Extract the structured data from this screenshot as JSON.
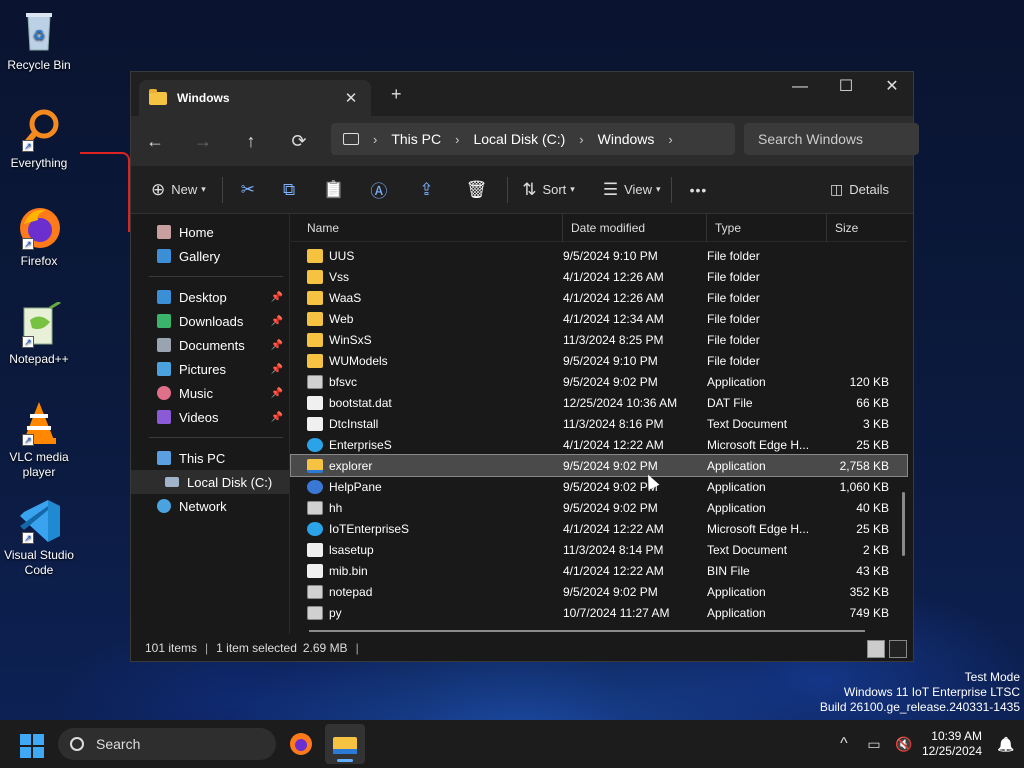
{
  "desktop": {
    "icons": [
      {
        "label": "Recycle Bin",
        "icon": "recycle-bin-icon"
      },
      {
        "label": "Everything",
        "icon": "everything-search-icon"
      },
      {
        "label": "Firefox",
        "icon": "firefox-icon"
      },
      {
        "label": "Notepad++",
        "icon": "notepad-plus-plus-icon"
      },
      {
        "label": "VLC media player",
        "icon": "vlc-icon"
      },
      {
        "label": "Visual Studio Code",
        "icon": "vscode-icon"
      }
    ]
  },
  "window": {
    "tab_title": "Windows",
    "tab_close": "✕",
    "new_tab": "+",
    "minimize": "—",
    "maximize": "☐",
    "close": "✕",
    "nav": {
      "back": "←",
      "forward": "→",
      "up": "↑",
      "refresh": "⟳"
    },
    "breadcrumb": [
      "This PC",
      "Local Disk (C:)",
      "Windows"
    ],
    "breadcrumb_sep": "›",
    "search_placeholder": "Search Windows",
    "toolbar": {
      "new": "New",
      "sort": "Sort",
      "view": "View",
      "more": "•••",
      "details": "Details",
      "cut": "✂",
      "copy": "⧉",
      "paste": "📋",
      "rename": "Ⓐ",
      "share": "⇪",
      "delete": "🗑"
    },
    "sidebar": {
      "top": [
        {
          "label": "Home",
          "color": "#d9534f"
        },
        {
          "label": "Gallery",
          "color": "#3a8fd6"
        }
      ],
      "pinned": [
        {
          "label": "Desktop",
          "color": "#3a8fd6",
          "pin": "📌"
        },
        {
          "label": "Downloads",
          "color": "#3bb46b",
          "pin": "📌"
        },
        {
          "label": "Documents",
          "color": "#9aa4b0",
          "pin": "📌"
        },
        {
          "label": "Pictures",
          "color": "#4aa3df",
          "pin": "📌"
        },
        {
          "label": "Music",
          "color": "#e0708a",
          "pin": "📌"
        },
        {
          "label": "Videos",
          "color": "#8b5ad6",
          "pin": "📌"
        }
      ],
      "this_pc": "This PC",
      "local_disk": "Local Disk (C:)",
      "network": "Network"
    },
    "columns": {
      "name": "Name",
      "date": "Date modified",
      "type": "Type",
      "size": "Size"
    },
    "files": [
      {
        "name": "UUS",
        "date": "9/5/2024 9:10 PM",
        "type": "File folder",
        "size": "",
        "icon": "folder"
      },
      {
        "name": "Vss",
        "date": "4/1/2024 12:26 AM",
        "type": "File folder",
        "size": "",
        "icon": "folder"
      },
      {
        "name": "WaaS",
        "date": "4/1/2024 12:26 AM",
        "type": "File folder",
        "size": "",
        "icon": "folder"
      },
      {
        "name": "Web",
        "date": "4/1/2024 12:34 AM",
        "type": "File folder",
        "size": "",
        "icon": "folder"
      },
      {
        "name": "WinSxS",
        "date": "11/3/2024 8:25 PM",
        "type": "File folder",
        "size": "",
        "icon": "folder"
      },
      {
        "name": "WUModels",
        "date": "9/5/2024 9:10 PM",
        "type": "File folder",
        "size": "",
        "icon": "folder"
      },
      {
        "name": "bfsvc",
        "date": "9/5/2024 9:02 PM",
        "type": "Application",
        "size": "120 KB",
        "icon": "app"
      },
      {
        "name": "bootstat.dat",
        "date": "12/25/2024 10:36 AM",
        "type": "DAT File",
        "size": "66 KB",
        "icon": "doc"
      },
      {
        "name": "DtcInstall",
        "date": "11/3/2024 8:16 PM",
        "type": "Text Document",
        "size": "3 KB",
        "icon": "doc"
      },
      {
        "name": "EnterpriseS",
        "date": "4/1/2024 12:22 AM",
        "type": "Microsoft Edge H...",
        "size": "25 KB",
        "icon": "edge"
      },
      {
        "name": "explorer",
        "date": "9/5/2024 9:02 PM",
        "type": "Application",
        "size": "2,758 KB",
        "icon": "explorer",
        "selected": true
      },
      {
        "name": "HelpPane",
        "date": "9/5/2024 9:02 PM",
        "type": "Application",
        "size": "1,060 KB",
        "icon": "help"
      },
      {
        "name": "hh",
        "date": "9/5/2024 9:02 PM",
        "type": "Application",
        "size": "40 KB",
        "icon": "app"
      },
      {
        "name": "IoTEnterpriseS",
        "date": "4/1/2024 12:22 AM",
        "type": "Microsoft Edge H...",
        "size": "25 KB",
        "icon": "edge"
      },
      {
        "name": "lsasetup",
        "date": "11/3/2024 8:14 PM",
        "type": "Text Document",
        "size": "2 KB",
        "icon": "doc"
      },
      {
        "name": "mib.bin",
        "date": "4/1/2024 12:22 AM",
        "type": "BIN File",
        "size": "43 KB",
        "icon": "doc"
      },
      {
        "name": "notepad",
        "date": "9/5/2024 9:02 PM",
        "type": "Application",
        "size": "352 KB",
        "icon": "app"
      },
      {
        "name": "py",
        "date": "10/7/2024 11:27 AM",
        "type": "Application",
        "size": "749 KB",
        "icon": "app"
      }
    ],
    "status": {
      "items": "101 items",
      "selected": "1 item selected",
      "size": "2.69 MB"
    }
  },
  "watermark": [
    "Test Mode",
    "Windows 11 IoT Enterprise LTSC",
    "Build 26100.ge_release.240331-1435"
  ],
  "taskbar": {
    "search": "Search",
    "time": "10:39 AM",
    "date": "12/25/2024",
    "tray_chevron": "^",
    "notification": "🔔"
  }
}
